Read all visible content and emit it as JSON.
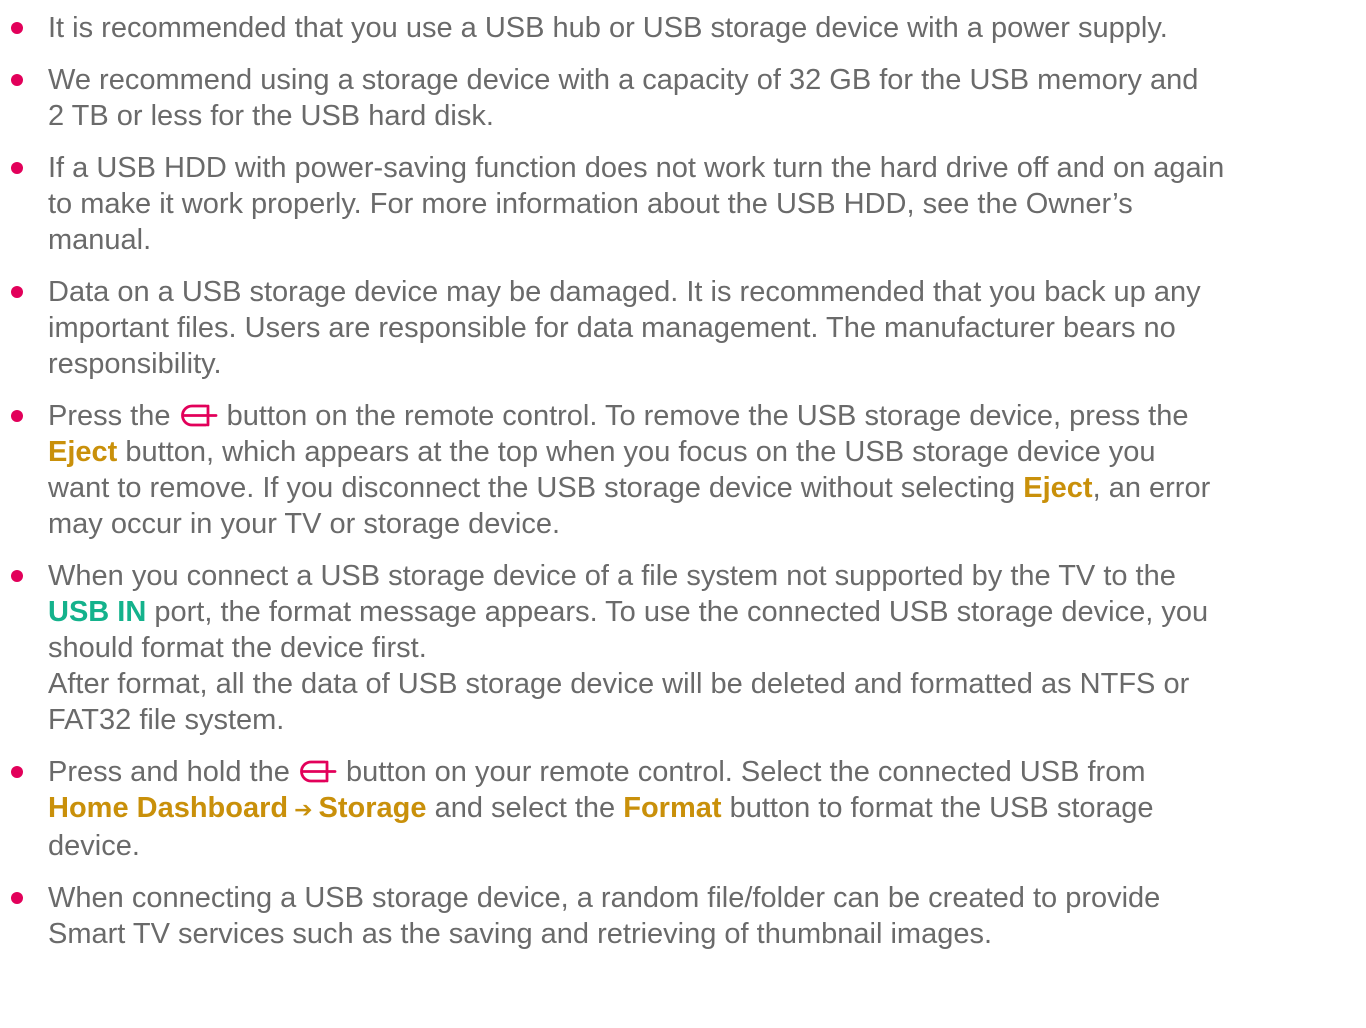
{
  "colors": {
    "bullet": "#e2005a",
    "keyword": "#c9900a",
    "port_keyword": "#14b28c",
    "text": "#6a6a6a",
    "icon": "#e2005a"
  },
  "icons": {
    "home": "home-remote-icon",
    "arrow": "arrow-right-icon"
  },
  "items": [
    {
      "text": "It is recommended that you use a USB hub or USB storage device with a power supply."
    },
    {
      "line1": "We recommend using a storage device with a capacity of 32 GB for the USB memory and",
      "line2": "2 TB or less for the USB hard disk."
    },
    {
      "line1": "If a USB HDD with power-saving function does not work turn the hard drive off and on again",
      "line2": "to make it work properly. For more information about the USB HDD, see the Owner’s",
      "line3": "manual."
    },
    {
      "line1": "Data on a USB storage device may be damaged. It is recommended that you back up any",
      "line2": "important files. Users are responsible for data management. The manufacturer bears no",
      "line3": "responsibility."
    },
    {
      "a": "Press the",
      "b": "button on the remote control. To remove the USB storage device, press the",
      "kw1": "Eject",
      "c": "button, which appears at the top when you focus on the USB storage device you",
      "d": "want to remove. If you disconnect the USB storage device without selecting",
      "kw2": "Eject",
      "e": ", an error",
      "f": "may occur in your TV or storage device."
    },
    {
      "a": "When you connect a USB storage device of a file system not supported by the TV to the",
      "kw": "USB IN",
      "b": "port, the format message appears. To use the connected USB storage device, you",
      "c": "should format the device first.",
      "d": "After format, all the data of USB storage device will be deleted and formatted as NTFS or",
      "e": "FAT32 file system."
    },
    {
      "a": "Press and hold the",
      "b": "button on your remote control. Select the connected USB from",
      "kw1": "Home Dashboard",
      "arrow": "➔",
      "kw2": "Storage",
      "c": "and select the",
      "kw3": "Format",
      "d": "button to format the USB storage",
      "e": "device."
    },
    {
      "line1": "When connecting a USB storage device, a random file/folder can be created to provide",
      "line2": "Smart TV services such as the saving and retrieving of thumbnail images."
    }
  ]
}
